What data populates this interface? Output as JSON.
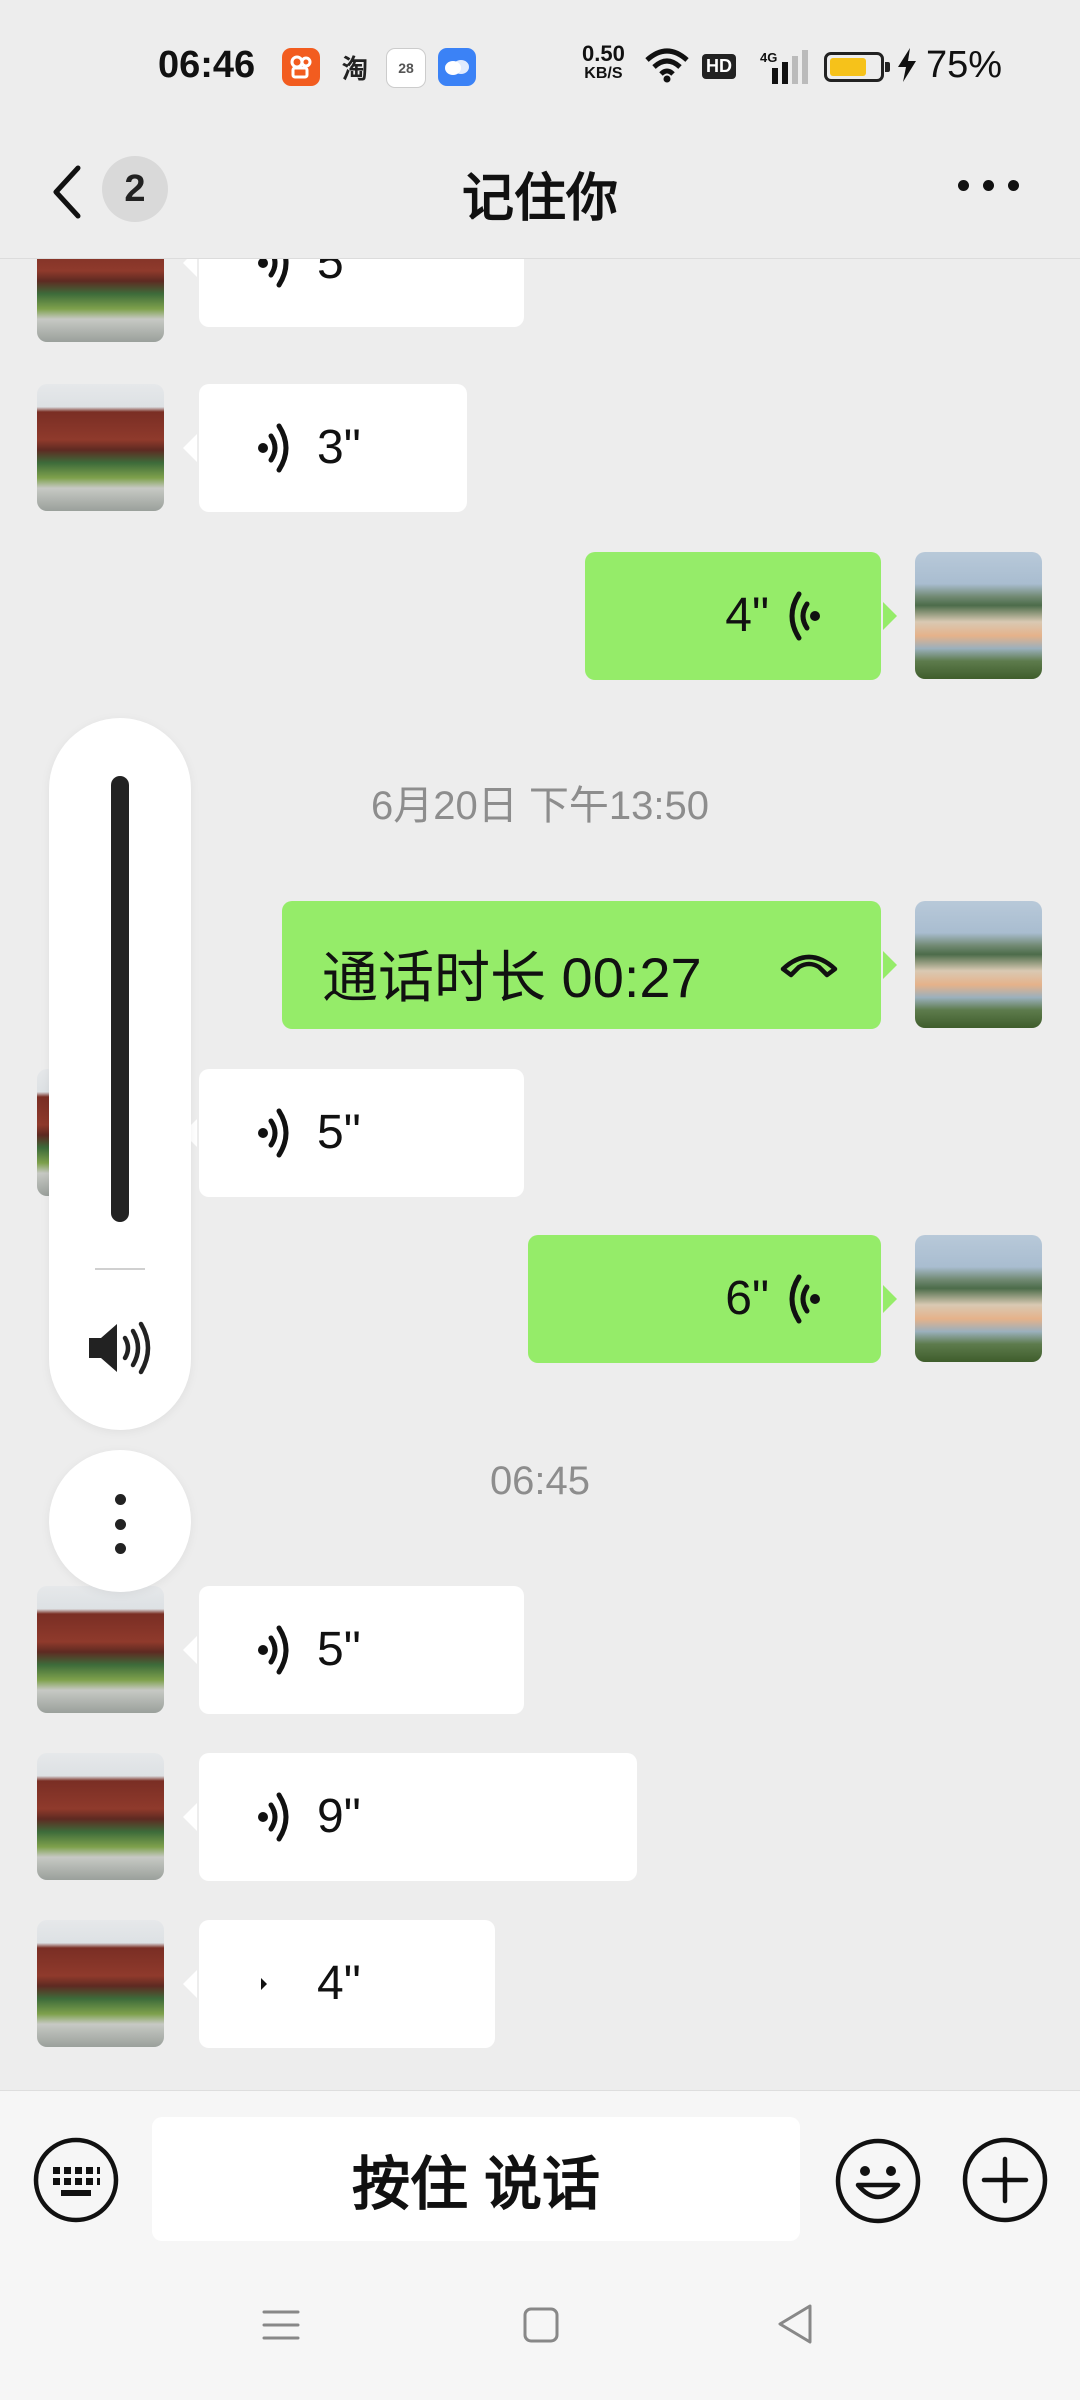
{
  "status_bar": {
    "time": "06:46",
    "apps": [
      "kuaishou-icon",
      "taobao-icon",
      "calendar-icon",
      "cloud-icon"
    ],
    "taobao_label": "淘",
    "calendar_day": "28",
    "net_speed": "0.50",
    "net_unit": "KB/S",
    "hd_label": "HD",
    "signal_label": "4G",
    "battery_percent": "75%",
    "battery_level": 0.75,
    "battery_color": "#f6c21a"
  },
  "header": {
    "title": "记住你",
    "unread_count": "2"
  },
  "messages": [
    {
      "dir": "in",
      "kind": "voice",
      "duration": "5\""
    },
    {
      "dir": "in",
      "kind": "voice",
      "duration": "3\""
    },
    {
      "dir": "out",
      "kind": "voice",
      "duration": "4\""
    },
    {
      "kind": "timestamp",
      "text": "6月20日 下午13:50"
    },
    {
      "dir": "out",
      "kind": "call",
      "text": "通话时长 00:27"
    },
    {
      "dir": "in",
      "kind": "voice",
      "duration": "5\""
    },
    {
      "dir": "out",
      "kind": "voice",
      "duration": "6\""
    },
    {
      "kind": "timestamp",
      "text": "06:45"
    },
    {
      "dir": "in",
      "kind": "voice",
      "duration": "5\""
    },
    {
      "dir": "in",
      "kind": "voice",
      "duration": "9\""
    },
    {
      "dir": "in",
      "kind": "voice",
      "duration": "4\""
    }
  ],
  "volume_panel": {
    "level": 1.0,
    "icon": "speaker-icon"
  },
  "input_bar": {
    "hold_to_talk": "按住 说话"
  },
  "colors": {
    "background": "#ededed",
    "outgoing_bubble": "#95ec69",
    "incoming_bubble": "#ffffff"
  }
}
